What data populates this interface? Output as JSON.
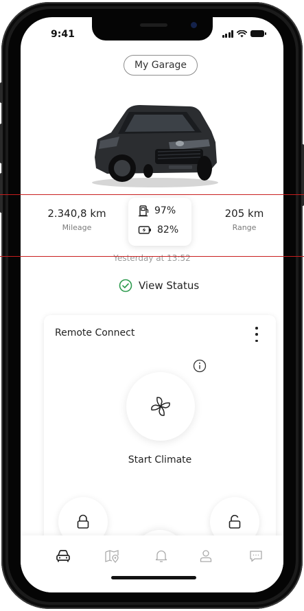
{
  "status_bar": {
    "time": "9:41"
  },
  "header": {
    "garage_label": "My Garage"
  },
  "vehicle": {
    "mileage_value": "2.340,8 km",
    "mileage_label": "Mileage",
    "range_value": "205 km",
    "range_label": "Range",
    "fuel_percent": "97%",
    "battery_percent": "82%",
    "updated": "Yesterday at 13:52",
    "view_status_label": "View Status"
  },
  "remote": {
    "title": "Remote Connect",
    "climate_label": "Start Climate"
  },
  "tabs": [
    {
      "icon": "car-icon"
    },
    {
      "icon": "map-icon"
    },
    {
      "icon": "bell-icon"
    },
    {
      "icon": "user-icon"
    },
    {
      "icon": "chat-icon"
    }
  ],
  "colors": {
    "accent_green": "#2e9b4f",
    "annotation_red": "#c81e1e",
    "text": "#222222",
    "muted": "#7a7a7a"
  }
}
